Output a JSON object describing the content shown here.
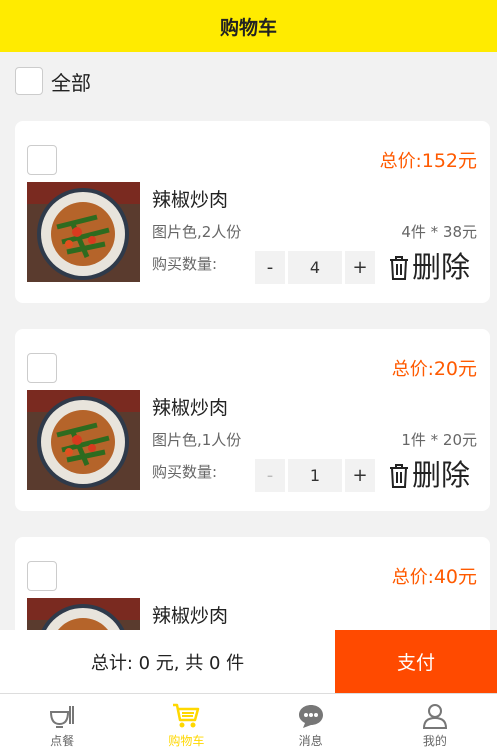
{
  "header": {
    "title": "购物车"
  },
  "select_all": {
    "label": "全部"
  },
  "items": [
    {
      "total_label": "总价:",
      "total_value": "152元",
      "name": "辣椒炒肉",
      "spec": "图片色,2人份",
      "price": "4件 * 38元",
      "qty_label": "购买数量:",
      "minus": "-",
      "qty": "4",
      "plus": "+",
      "delete_label": "删除",
      "minus_disabled": false
    },
    {
      "total_label": "总价:",
      "total_value": "20元",
      "name": "辣椒炒肉",
      "spec": "图片色,1人份",
      "price": "1件 * 20元",
      "qty_label": "购买数量:",
      "minus": "-",
      "qty": "1",
      "plus": "+",
      "delete_label": "删除",
      "minus_disabled": true
    },
    {
      "total_label": "总价:",
      "total_value": "40元",
      "name": "辣椒炒肉"
    }
  ],
  "footer": {
    "summary": "总计: 0 元, 共 0 件",
    "pay_label": "支付"
  },
  "tabbar": [
    {
      "label": "点餐",
      "icon": "bowl-icon",
      "active": false
    },
    {
      "label": "购物车",
      "icon": "cart-icon",
      "active": true
    },
    {
      "label": "消息",
      "icon": "chat-icon",
      "active": false
    },
    {
      "label": "我的",
      "icon": "user-icon",
      "active": false
    }
  ],
  "colors": {
    "header_bg": "#ffeb00",
    "accent": "#ff5a00",
    "pay_bg": "#ff4a00",
    "tab_active": "#ffd800"
  }
}
